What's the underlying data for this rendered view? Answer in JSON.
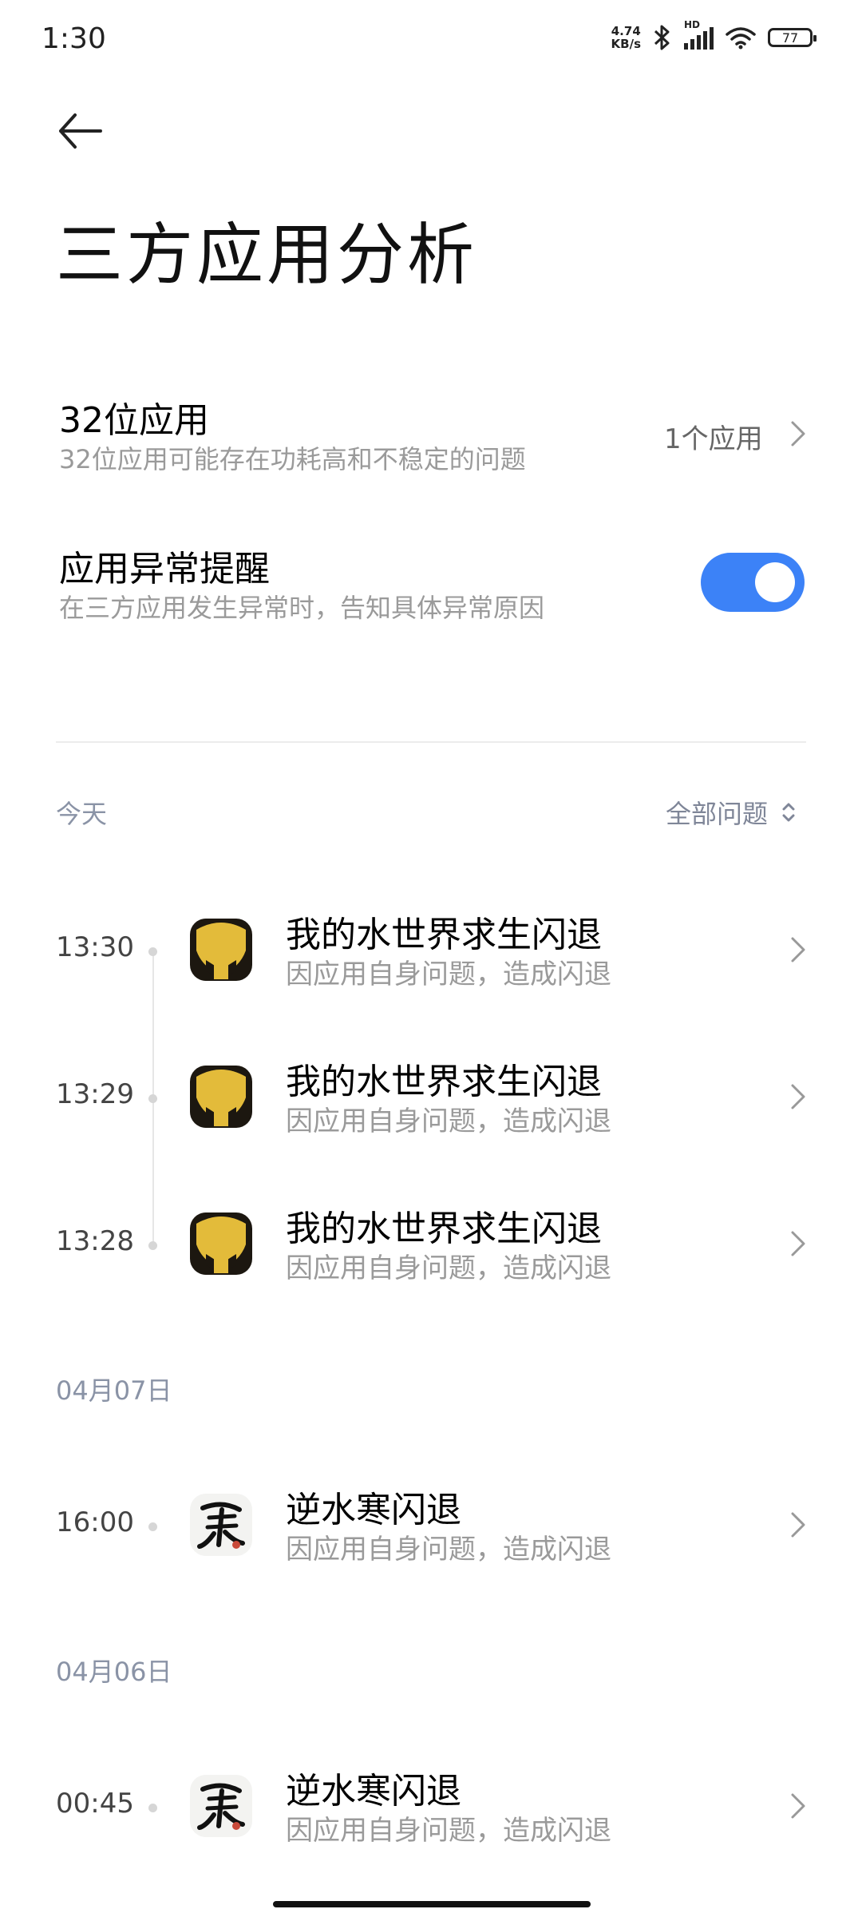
{
  "status_bar": {
    "time": "1:30",
    "net_speed_value": "4.74",
    "net_speed_unit": "KB/s",
    "network_label": "HD",
    "battery": "77",
    "icons": [
      "bluetooth-icon",
      "signal-icon",
      "wifi-icon",
      "battery-icon"
    ]
  },
  "header": {
    "back_icon": "arrow-left-icon",
    "title": "三方应用分析"
  },
  "settings": {
    "bit32": {
      "title": "32位应用",
      "subtitle": "32位应用可能存在功耗高和不稳定的问题",
      "value": "1个应用"
    },
    "alert": {
      "title": "应用异常提醒",
      "subtitle": "在三方应用发生异常时，告知具体异常原因",
      "enabled": true
    }
  },
  "filter": {
    "label": "全部问题"
  },
  "sections": [
    {
      "label": "今天",
      "items": [
        {
          "time": "13:30",
          "title": "我的水世界求生闪退",
          "subtitle": "因应用自身问题，造成闪退",
          "icon": "yellow-shield-game-icon"
        },
        {
          "time": "13:29",
          "title": "我的水世界求生闪退",
          "subtitle": "因应用自身问题，造成闪退",
          "icon": "yellow-shield-game-icon"
        },
        {
          "time": "13:28",
          "title": "我的水世界求生闪退",
          "subtitle": "因应用自身问题，造成闪退",
          "icon": "yellow-shield-game-icon"
        }
      ]
    },
    {
      "label": "04月07日",
      "items": [
        {
          "time": "16:00",
          "title": "逆水寒闪退",
          "subtitle": "因应用自身问题，造成闪退",
          "icon": "ink-calligraphy-game-icon"
        }
      ]
    },
    {
      "label": "04月06日",
      "items": [
        {
          "time": "00:45",
          "title": "逆水寒闪退",
          "subtitle": "因应用自身问题，造成闪退",
          "icon": "ink-calligraphy-game-icon"
        }
      ]
    }
  ],
  "colors": {
    "accent": "#3c82f7",
    "subtext": "#9a9a9a",
    "section": "#8a93a6"
  }
}
